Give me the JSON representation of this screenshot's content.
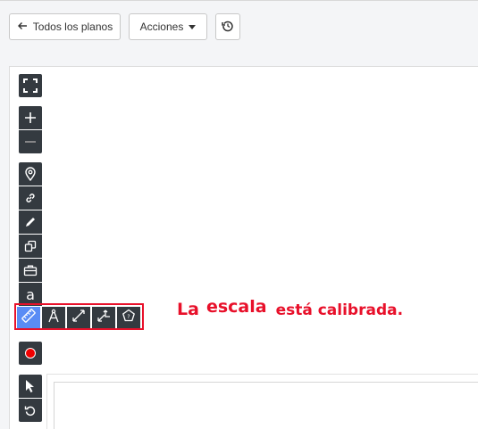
{
  "header": {
    "back_label": "Todos los planos",
    "actions_label": "Acciones",
    "back_icon": "arrow-left-icon",
    "actions_icon": "caret-down-icon",
    "history_icon": "history-icon"
  },
  "toolbar": {
    "icons": [
      "fullscreen-icon",
      "zoom-in-icon",
      "zoom-out-icon",
      "map-pin-icon",
      "link-icon",
      "pencil-icon",
      "copy-icon",
      "toolbox-icon",
      "text-icon",
      "record-icon",
      "pointer-icon",
      "undo-icon"
    ],
    "text_tool_label": "a"
  },
  "scale_tools": {
    "icons": [
      "ruler-icon",
      "compass-icon",
      "diagonal-measure-icon",
      "area-measure-icon",
      "polygon-help-icon"
    ]
  },
  "annotation": {
    "part1": "La",
    "part2": "escala",
    "part3": "está calibrada.",
    "color": "#e8102a"
  },
  "colors": {
    "toolbar_bg": "#343a40",
    "active_tool": "#5a8cf5",
    "record": "#f00000"
  }
}
